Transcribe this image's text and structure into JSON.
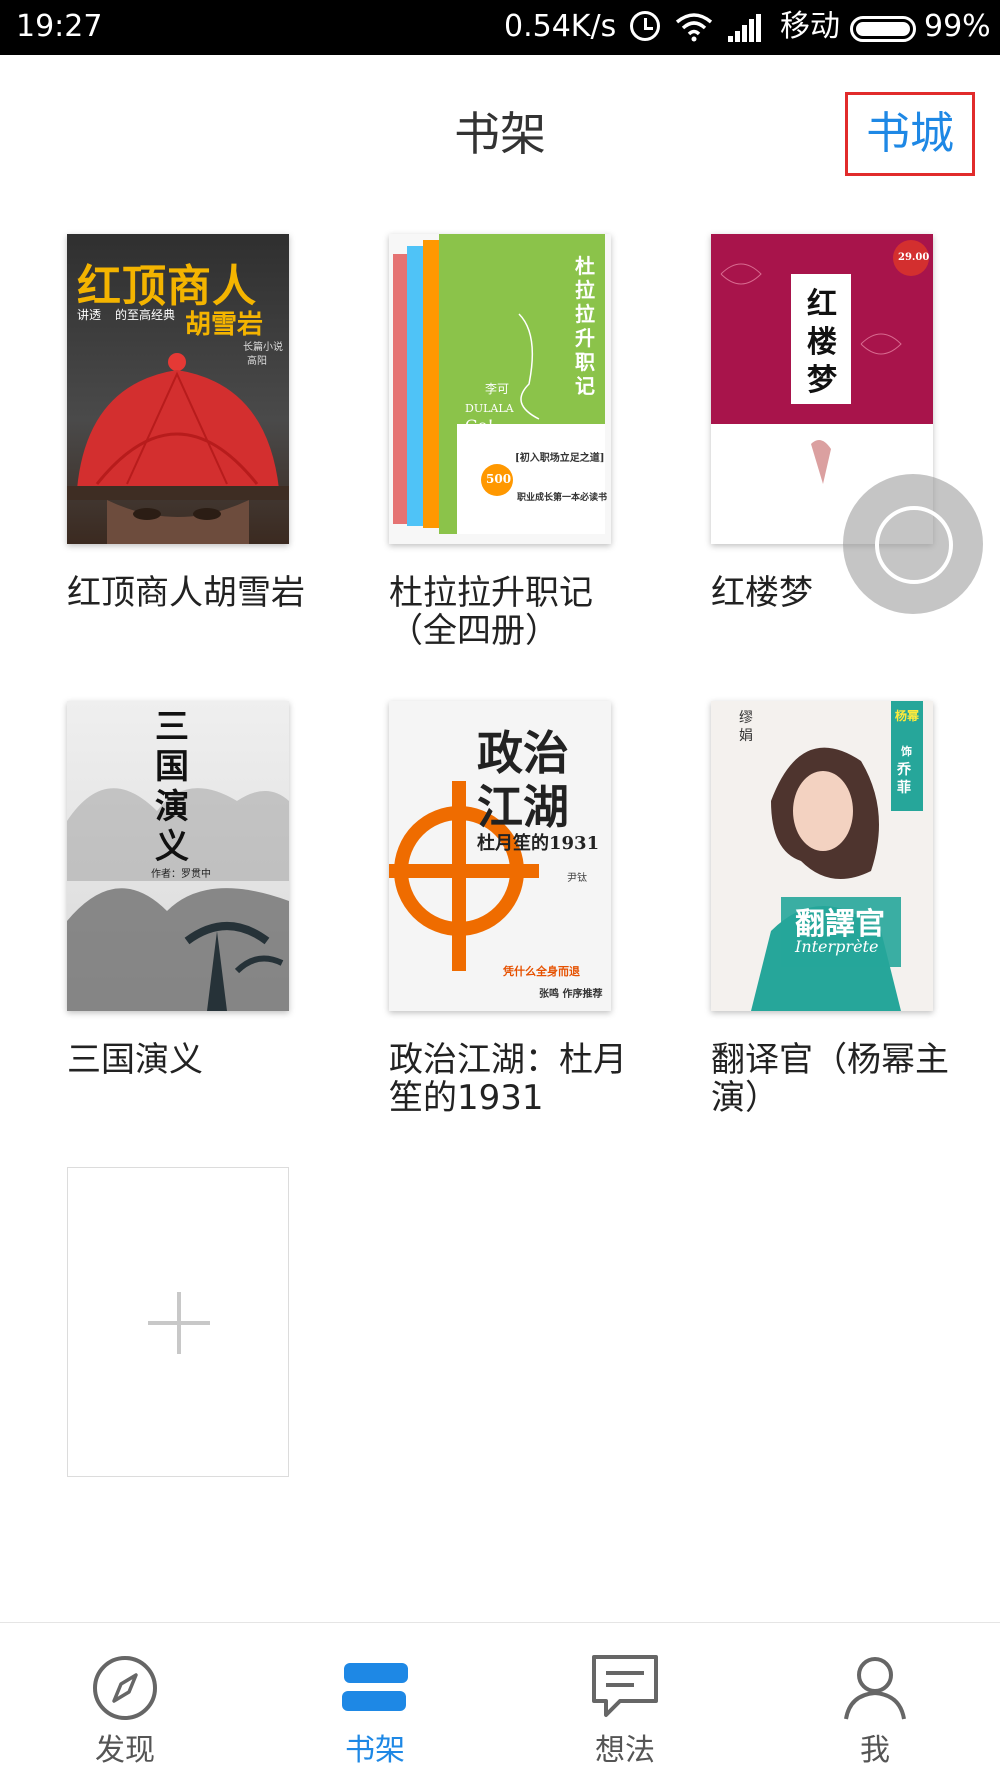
{
  "status_bar": {
    "time": "19:27",
    "speed": "0.54K/s",
    "carrier": "移动",
    "battery": "99%"
  },
  "header": {
    "title": "书架",
    "bookstore_label": "书城"
  },
  "books": [
    {
      "title": "红顶商人胡雪岩",
      "cover": {
        "big_text": "红顶商人",
        "sub_text": "胡雪岩",
        "tagline": "讲透",
        "tagline2": "的至高经典",
        "small_text": "长篇小说",
        "author": "高阳"
      }
    },
    {
      "title": "杜拉拉升职记（全四册）",
      "cover": {
        "big_text": "杜拉拉升职记",
        "author": "李可",
        "brand": "DULALA",
        "go": "Go!",
        "bracket": "[初入职场立足之道]",
        "price_badge": "500",
        "line1": "职业成长第一本必读书"
      }
    },
    {
      "title": "红楼梦",
      "cover": {
        "big_text": "红楼梦",
        "price": "29.00"
      }
    },
    {
      "title": "三国演义",
      "cover": {
        "big_text": "三国演义",
        "author_line": "作者：罗贯中"
      }
    },
    {
      "title": "政治江湖：杜月笙的1931",
      "cover": {
        "big_text1": "政治",
        "big_text2": "江湖",
        "sub_text": "杜月笙的1931",
        "author": "尹钛",
        "line1": "凭什么全身而退",
        "footer": "张鸣 作序推荐"
      }
    },
    {
      "title": "翻译官（杨幂主演）",
      "cover": {
        "tag1": "杨幂",
        "tag2": "饰",
        "tag3": "乔菲",
        "author": "缪娟",
        "big_text": "翻譯官",
        "script": "Interprète"
      }
    }
  ],
  "bottom_nav": [
    {
      "label": "发现",
      "icon": "compass-icon",
      "active": false
    },
    {
      "label": "书架",
      "icon": "bookshelf-icon",
      "active": true
    },
    {
      "label": "想法",
      "icon": "chat-icon",
      "active": false
    },
    {
      "label": "我",
      "icon": "person-icon",
      "active": false
    }
  ],
  "colors": {
    "accent": "#1e88e5",
    "highlight_border": "#e12b2b"
  }
}
